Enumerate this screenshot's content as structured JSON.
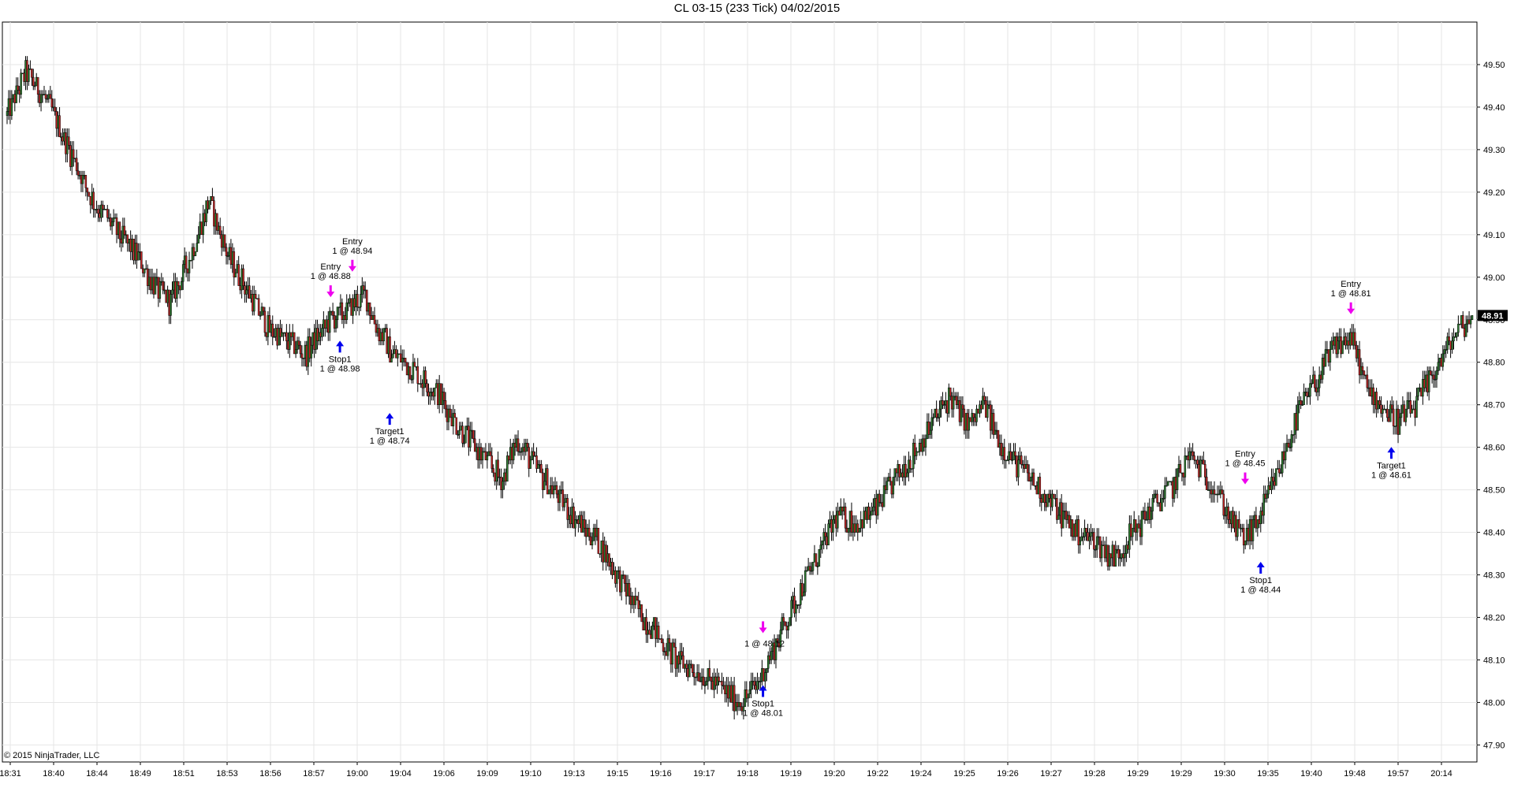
{
  "chart_data": {
    "type": "candlestick",
    "title": "CL 03-15 (233 Tick)  04/02/2015",
    "copyright": "© 2015 NinjaTrader, LLC",
    "last_price": "48.91",
    "ylim": [
      47.86,
      49.6
    ],
    "y_ticks": [
      "49.50",
      "49.40",
      "49.30",
      "49.20",
      "49.10",
      "49.00",
      "48.90",
      "48.80",
      "48.70",
      "48.60",
      "48.50",
      "48.40",
      "48.30",
      "48.20",
      "48.10",
      "48.00",
      "47.90"
    ],
    "x_ticks": [
      "18:31",
      "18:40",
      "18:44",
      "18:49",
      "18:51",
      "18:53",
      "18:56",
      "18:57",
      "19:00",
      "19:04",
      "19:06",
      "19:09",
      "19:10",
      "19:13",
      "19:15",
      "19:16",
      "19:17",
      "19:18",
      "19:19",
      "19:20",
      "19:22",
      "19:24",
      "19:25",
      "19:26",
      "19:27",
      "19:28",
      "19:29",
      "19:29",
      "19:30",
      "19:35",
      "19:40",
      "19:48",
      "19:57",
      "20:14"
    ],
    "colors": {
      "up": "#2e7d32",
      "down": "#c62828",
      "wick": "#000000",
      "buy": "#0000ee",
      "sell": "#ee00ee",
      "grid": "#e6e6e6"
    },
    "close_path": [
      [
        0,
        49.38
      ],
      [
        12,
        49.48
      ],
      [
        25,
        49.42
      ],
      [
        40,
        49.3
      ],
      [
        55,
        49.18
      ],
      [
        68,
        49.12
      ],
      [
        82,
        49.06
      ],
      [
        95,
        48.98
      ],
      [
        105,
        48.94
      ],
      [
        118,
        49.05
      ],
      [
        130,
        49.18
      ],
      [
        142,
        49.05
      ],
      [
        156,
        48.96
      ],
      [
        168,
        48.88
      ],
      [
        180,
        48.85
      ],
      [
        192,
        48.82
      ],
      [
        208,
        48.9
      ],
      [
        218,
        48.92
      ],
      [
        230,
        48.96
      ],
      [
        238,
        48.88
      ],
      [
        248,
        48.82
      ],
      [
        262,
        48.78
      ],
      [
        278,
        48.72
      ],
      [
        292,
        48.64
      ],
      [
        306,
        48.58
      ],
      [
        318,
        48.52
      ],
      [
        328,
        48.62
      ],
      [
        340,
        48.55
      ],
      [
        355,
        48.48
      ],
      [
        368,
        48.42
      ],
      [
        380,
        48.38
      ],
      [
        392,
        48.3
      ],
      [
        405,
        48.22
      ],
      [
        418,
        48.16
      ],
      [
        430,
        48.1
      ],
      [
        445,
        48.07
      ],
      [
        460,
        48.03
      ],
      [
        472,
        48.0
      ],
      [
        482,
        48.04
      ],
      [
        492,
        48.12
      ],
      [
        502,
        48.2
      ],
      [
        512,
        48.28
      ],
      [
        522,
        48.35
      ],
      [
        534,
        48.44
      ],
      [
        546,
        48.42
      ],
      [
        558,
        48.45
      ],
      [
        570,
        48.52
      ],
      [
        582,
        48.58
      ],
      [
        594,
        48.65
      ],
      [
        606,
        48.72
      ],
      [
        618,
        48.65
      ],
      [
        628,
        48.7
      ],
      [
        640,
        48.6
      ],
      [
        652,
        48.55
      ],
      [
        664,
        48.5
      ],
      [
        676,
        48.45
      ],
      [
        688,
        48.4
      ],
      [
        700,
        48.38
      ],
      [
        712,
        48.34
      ],
      [
        724,
        48.4
      ],
      [
        736,
        48.46
      ],
      [
        748,
        48.5
      ],
      [
        760,
        48.58
      ],
      [
        770,
        48.54
      ],
      [
        780,
        48.48
      ],
      [
        788,
        48.42
      ],
      [
        796,
        48.38
      ],
      [
        806,
        48.44
      ],
      [
        818,
        48.55
      ],
      [
        830,
        48.68
      ],
      [
        842,
        48.76
      ],
      [
        854,
        48.84
      ],
      [
        864,
        48.86
      ],
      [
        874,
        48.74
      ],
      [
        884,
        48.7
      ],
      [
        894,
        48.66
      ],
      [
        906,
        48.7
      ],
      [
        918,
        48.78
      ],
      [
        930,
        48.86
      ],
      [
        942,
        48.91
      ]
    ],
    "annotations": [
      {
        "id": "entry-short-1",
        "label": "Entry",
        "sub": "1 @ 48.88",
        "kind": "sell",
        "x": 208,
        "y": 48.94,
        "label_pos": "above"
      },
      {
        "id": "entry-short-2",
        "label": "Entry",
        "sub": "1 @ 48.94",
        "kind": "sell",
        "x": 222,
        "y": 49.0,
        "label_pos": "above"
      },
      {
        "id": "stop-1",
        "label": "Stop1",
        "sub": "1 @ 48.98",
        "kind": "buy",
        "x": 214,
        "y": 48.86,
        "label_pos": "below"
      },
      {
        "id": "target-1",
        "label": "Target1",
        "sub": "1 @ 48.74",
        "kind": "buy",
        "x": 246,
        "y": 48.69,
        "label_pos": "below"
      },
      {
        "id": "entry-long-low",
        "label": "",
        "sub": "1 @ 48.12",
        "kind": "sell",
        "x": 486,
        "y": 48.15,
        "label_pos": "none"
      },
      {
        "id": "stop-2",
        "label": "Stop1",
        "sub": "1 @ 48.01",
        "kind": "buy",
        "x": 486,
        "y": 48.05,
        "label_pos": "below"
      },
      {
        "id": "entry-short-3",
        "label": "Entry",
        "sub": "1 @ 48.45",
        "kind": "sell",
        "x": 796,
        "y": 48.5,
        "label_pos": "above"
      },
      {
        "id": "stop-3",
        "label": "Stop1",
        "sub": "1 @ 48.44",
        "kind": "buy",
        "x": 806,
        "y": 48.34,
        "label_pos": "below"
      },
      {
        "id": "entry-short-4",
        "label": "Entry",
        "sub": "1 @ 48.81",
        "kind": "sell",
        "x": 864,
        "y": 48.9,
        "label_pos": "above"
      },
      {
        "id": "target-2",
        "label": "Target1",
        "sub": "1 @ 48.61",
        "kind": "buy",
        "x": 890,
        "y": 48.61,
        "label_pos": "below"
      }
    ]
  }
}
